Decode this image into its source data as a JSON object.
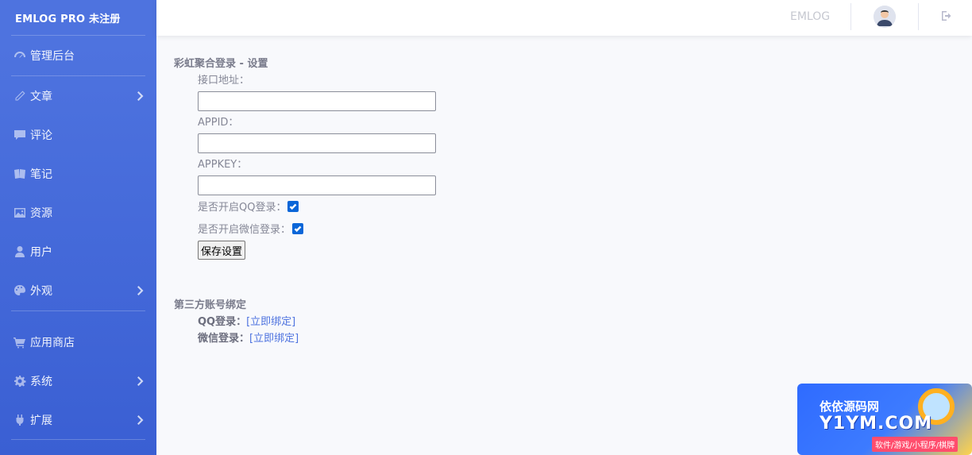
{
  "sidebar": {
    "brand": "EMLOG PRO 未注册",
    "items": [
      {
        "label": "管理后台",
        "icon": "dashboard-icon",
        "has_chevron": false
      },
      {
        "label": "文章",
        "icon": "pencil-icon",
        "has_chevron": true
      },
      {
        "label": "评论",
        "icon": "comment-icon",
        "has_chevron": false
      },
      {
        "label": "笔记",
        "icon": "notes-icon",
        "has_chevron": false
      },
      {
        "label": "资源",
        "icon": "image-icon",
        "has_chevron": false
      },
      {
        "label": "用户",
        "icon": "user-icon",
        "has_chevron": false
      },
      {
        "label": "外观",
        "icon": "palette-icon",
        "has_chevron": true
      },
      {
        "label": "应用商店",
        "icon": "cart-icon",
        "has_chevron": false
      },
      {
        "label": "系统",
        "icon": "gear-icon",
        "has_chevron": true
      },
      {
        "label": "扩展",
        "icon": "plug-icon",
        "has_chevron": true
      }
    ]
  },
  "topbar": {
    "site_name": "EMLOG"
  },
  "settings": {
    "title": "彩虹聚合登录 - 设置",
    "api_url_label": "接口地址：",
    "api_url_value": "",
    "appid_label": "APPID：",
    "appid_value": "",
    "appkey_label": "APPKEY：",
    "appkey_value": "",
    "qq_login_label": "是否开启QQ登录：",
    "qq_login_checked": true,
    "wechat_login_label": "是否开启微信登录：",
    "wechat_login_checked": true,
    "save_label": "保存设置"
  },
  "binding": {
    "title": "第三方账号绑定",
    "qq_label": "QQ登录：",
    "qq_link": "[立即绑定]",
    "wechat_label": "微信登录：",
    "wechat_link": "[立即绑定]"
  },
  "watermark": {
    "line1": "依依源码网",
    "line2": "Y1YM.COM",
    "tag": "软件/游戏/小程序/棋牌"
  },
  "colors": {
    "sidebar": "#4e73df",
    "checkbox": "#0a66d8",
    "link": "#4e73df"
  }
}
